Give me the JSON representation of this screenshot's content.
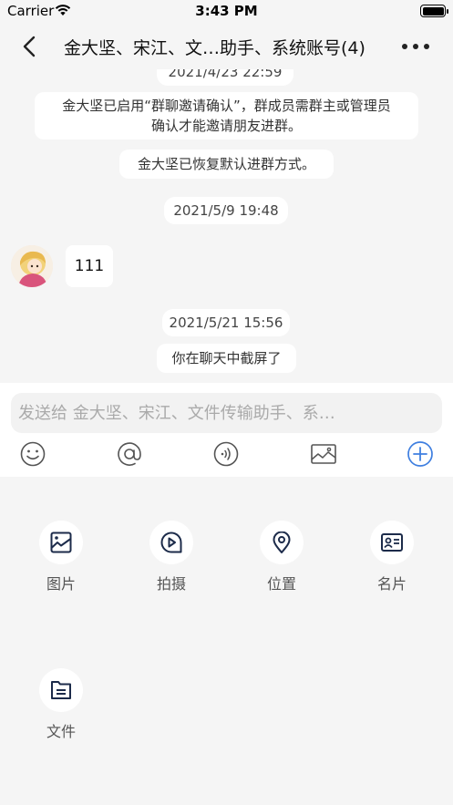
{
  "status_bar": {
    "carrier": "Carrier",
    "time": "3:43 PM"
  },
  "nav": {
    "title": "金大坚、宋江、文…助手、系统账号(4)"
  },
  "chat": {
    "time1": "2021/4/23 22:59",
    "sys1_line1": "金大坚已启用“群聊邀请确认”，群成员需群主或管理员",
    "sys1_line2": "确认才能邀请朋友进群。",
    "sys2": "金大坚已恢复默认进群方式。",
    "time2": "2021/5/9 19:48",
    "message_text": "111",
    "time3": "2021/5/21 15:56",
    "sys3": "你在聊天中截屏了"
  },
  "input": {
    "placeholder": "发送给 金大坚、宋江、文件传输助手、系…"
  },
  "toolbar": {
    "icons": [
      "emoji-icon",
      "mention-icon",
      "voice-icon",
      "image-icon",
      "plus-icon"
    ],
    "accent": "#3f7fe0"
  },
  "panel": {
    "items": [
      {
        "label": "图片",
        "icon": "picture-icon"
      },
      {
        "label": "拍摄",
        "icon": "camera-play-icon"
      },
      {
        "label": "位置",
        "icon": "location-icon"
      },
      {
        "label": "名片",
        "icon": "contact-card-icon"
      },
      {
        "label": "文件",
        "icon": "file-icon"
      }
    ],
    "icon_color": "#1c2b4a"
  }
}
